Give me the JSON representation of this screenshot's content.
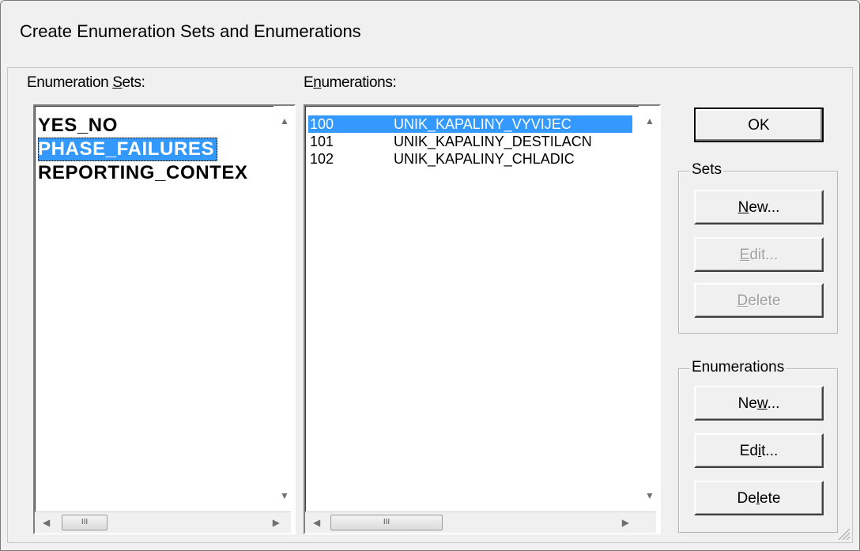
{
  "window": {
    "title": "Create Enumeration Sets and Enumerations"
  },
  "sets_panel": {
    "label_pre": "Enumeration ",
    "label_u": "S",
    "label_post": "ets:",
    "items": [
      "YES_NO",
      "PHASE_FAILURES",
      "REPORTING_CONTEX"
    ],
    "selected_index": 1
  },
  "enums_panel": {
    "label_pre": "E",
    "label_u": "n",
    "label_post": "umerations:",
    "items": [
      {
        "value": "100",
        "name": "UNIK_KAPALINY_VYVIJEC"
      },
      {
        "value": "101",
        "name": "UNIK_KAPALINY_DESTILACN"
      },
      {
        "value": "102",
        "name": "UNIK_KAPALINY_CHLADIC"
      }
    ],
    "selected_index": 0
  },
  "scrollbar": {
    "thumb_grip": "III"
  },
  "buttons": {
    "ok": "OK",
    "sets_group_label": "Sets",
    "sets_new": {
      "pre": "",
      "u": "N",
      "post": "ew..."
    },
    "sets_edit": {
      "pre": "",
      "u": "E",
      "post": "dit..."
    },
    "sets_delete": {
      "pre": "",
      "u": "D",
      "post": "elete"
    },
    "enums_group_label": "Enumerations",
    "enums_new": {
      "pre": "Ne",
      "u": "w",
      "post": "..."
    },
    "enums_edit": {
      "pre": "Ed",
      "u": "i",
      "post": "t..."
    },
    "enums_delete": {
      "pre": "De",
      "u": "l",
      "post": "ete"
    }
  },
  "colors": {
    "selection": "#3399ff",
    "face": "#f0f0f0"
  }
}
